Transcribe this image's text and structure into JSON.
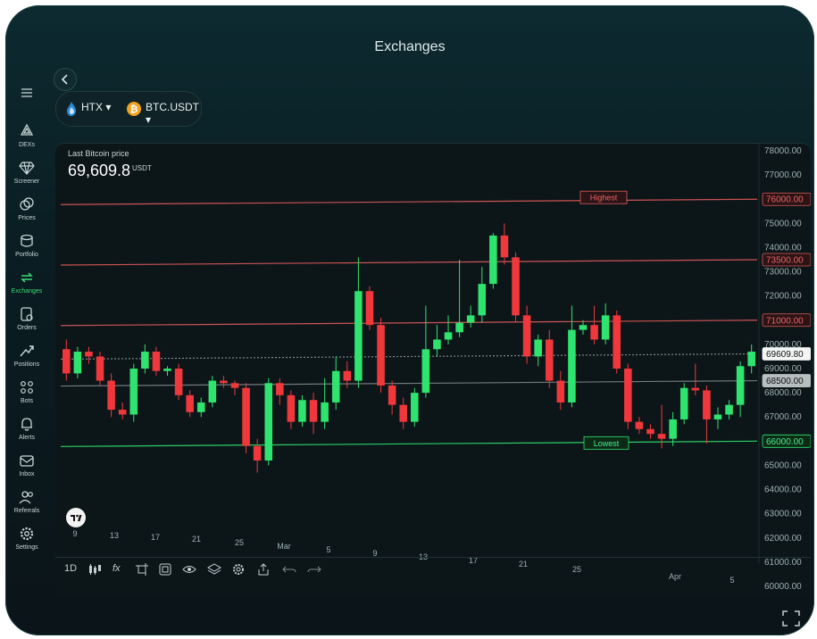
{
  "app": {
    "title": "Exchanges"
  },
  "sidebar": {
    "items": [
      {
        "label": "DEXs",
        "icon": "dex-icon"
      },
      {
        "label": "Screener",
        "icon": "diamond-icon"
      },
      {
        "label": "Prices",
        "icon": "coins-icon"
      },
      {
        "label": "Portfolio",
        "icon": "portfolio-icon"
      },
      {
        "label": "Exchanges",
        "icon": "exchange-arrows-icon",
        "active": true
      },
      {
        "label": "Orders",
        "icon": "orders-icon"
      },
      {
        "label": "Positions",
        "icon": "positions-icon"
      },
      {
        "label": "Bots",
        "icon": "bots-icon"
      },
      {
        "label": "Alerts",
        "icon": "bell-icon"
      },
      {
        "label": "Inbox",
        "icon": "mail-icon"
      },
      {
        "label": "Referrals",
        "icon": "users-icon"
      },
      {
        "label": "Settings",
        "icon": "gear-icon"
      }
    ]
  },
  "selector": {
    "exchange": "HTX",
    "pair": "BTC.USDT"
  },
  "header": {
    "price_label": "Last Bitcoin price",
    "price_value": "69,609.8",
    "price_unit": "USDT"
  },
  "toolbar": {
    "interval": "1D",
    "fx": "fx"
  },
  "colors": {
    "up": "#2fe36f",
    "down": "#f0383c",
    "resistance": "#e05a5a",
    "support": "#2fe36f"
  },
  "chart_data": {
    "type": "candlestick",
    "ylim": [
      60000,
      78000
    ],
    "y_ticks": [
      "78000.00",
      "77000.00",
      "76000.00",
      "75000.00",
      "74000.00",
      "73000.00",
      "72000.00",
      "71000.00",
      "70000.00",
      "69000.00",
      "68000.00",
      "67000.00",
      "66000.00",
      "65000.00",
      "64000.00",
      "63000.00",
      "62000.00",
      "61000.00",
      "60000.00"
    ],
    "x_tick_labels": [
      "9",
      "13",
      "17",
      "21",
      "25",
      "Mar",
      "5",
      "9",
      "13",
      "17",
      "21",
      "25",
      "Apr",
      "5"
    ],
    "levels": [
      {
        "label": "76000.00",
        "value": 76000,
        "kind": "resistance"
      },
      {
        "label": "73500.00",
        "value": 73500,
        "kind": "resistance"
      },
      {
        "label": "71000.00",
        "value": 71000,
        "kind": "resistance"
      },
      {
        "label": "69609.80",
        "value": 69609.8,
        "kind": "current"
      },
      {
        "label": "68500.00",
        "value": 68500,
        "kind": "neutral"
      },
      {
        "label": "66000.00",
        "value": 66000,
        "kind": "support"
      }
    ],
    "annotations": {
      "highest": "Highest",
      "lowest": "Lowest"
    },
    "candles": [
      {
        "o": 69800,
        "c": 68800,
        "h": 70200,
        "l": 68500
      },
      {
        "o": 68800,
        "c": 69700,
        "h": 69900,
        "l": 68600
      },
      {
        "o": 69700,
        "c": 69500,
        "h": 69900,
        "l": 69200
      },
      {
        "o": 69500,
        "c": 68500,
        "h": 69700,
        "l": 68300
      },
      {
        "o": 68500,
        "c": 67300,
        "h": 68800,
        "l": 67000
      },
      {
        "o": 67300,
        "c": 67100,
        "h": 67600,
        "l": 66900
      },
      {
        "o": 67100,
        "c": 69000,
        "h": 69200,
        "l": 66800
      },
      {
        "o": 69000,
        "c": 69700,
        "h": 70000,
        "l": 68800
      },
      {
        "o": 69700,
        "c": 68900,
        "h": 69900,
        "l": 68700
      },
      {
        "o": 68900,
        "c": 69000,
        "h": 69100,
        "l": 68700
      },
      {
        "o": 69000,
        "c": 67900,
        "h": 69200,
        "l": 67700
      },
      {
        "o": 67900,
        "c": 67200,
        "h": 68100,
        "l": 67000
      },
      {
        "o": 67200,
        "c": 67600,
        "h": 67800,
        "l": 67000
      },
      {
        "o": 67600,
        "c": 68500,
        "h": 68700,
        "l": 67400
      },
      {
        "o": 68500,
        "c": 68400,
        "h": 68700,
        "l": 68200
      },
      {
        "o": 68400,
        "c": 68200,
        "h": 68500,
        "l": 67900
      },
      {
        "o": 68200,
        "c": 65800,
        "h": 68400,
        "l": 65500
      },
      {
        "o": 65800,
        "c": 65200,
        "h": 66100,
        "l": 64700
      },
      {
        "o": 65200,
        "c": 68400,
        "h": 68600,
        "l": 65000
      },
      {
        "o": 68400,
        "c": 67900,
        "h": 68600,
        "l": 67500
      },
      {
        "o": 67900,
        "c": 66800,
        "h": 68100,
        "l": 66500
      },
      {
        "o": 66800,
        "c": 67700,
        "h": 67900,
        "l": 66600
      },
      {
        "o": 67700,
        "c": 66800,
        "h": 68000,
        "l": 66300
      },
      {
        "o": 66800,
        "c": 67600,
        "h": 68600,
        "l": 66500
      },
      {
        "o": 67600,
        "c": 68900,
        "h": 69500,
        "l": 67300
      },
      {
        "o": 68900,
        "c": 68500,
        "h": 69300,
        "l": 68200
      },
      {
        "o": 68500,
        "c": 72200,
        "h": 73600,
        "l": 68200
      },
      {
        "o": 72200,
        "c": 70800,
        "h": 72400,
        "l": 70600
      },
      {
        "o": 70800,
        "c": 68300,
        "h": 71100,
        "l": 68000
      },
      {
        "o": 68300,
        "c": 67500,
        "h": 68500,
        "l": 67100
      },
      {
        "o": 67500,
        "c": 66800,
        "h": 67800,
        "l": 66500
      },
      {
        "o": 66800,
        "c": 68000,
        "h": 68200,
        "l": 66600
      },
      {
        "o": 68000,
        "c": 69800,
        "h": 71600,
        "l": 67800
      },
      {
        "o": 69800,
        "c": 70200,
        "h": 70800,
        "l": 69500
      },
      {
        "o": 70200,
        "c": 70500,
        "h": 71200,
        "l": 70000
      },
      {
        "o": 70500,
        "c": 70900,
        "h": 73500,
        "l": 70300
      },
      {
        "o": 70900,
        "c": 71200,
        "h": 71600,
        "l": 70700
      },
      {
        "o": 71200,
        "c": 72500,
        "h": 73200,
        "l": 70900
      },
      {
        "o": 72500,
        "c": 74500,
        "h": 74600,
        "l": 72300
      },
      {
        "o": 74500,
        "c": 73600,
        "h": 75000,
        "l": 73300
      },
      {
        "o": 73600,
        "c": 71200,
        "h": 73800,
        "l": 70900
      },
      {
        "o": 71200,
        "c": 69500,
        "h": 71600,
        "l": 69200
      },
      {
        "o": 69500,
        "c": 70200,
        "h": 70400,
        "l": 69100
      },
      {
        "o": 70200,
        "c": 68500,
        "h": 70600,
        "l": 68200
      },
      {
        "o": 68500,
        "c": 67600,
        "h": 68900,
        "l": 67300
      },
      {
        "o": 67600,
        "c": 70600,
        "h": 71600,
        "l": 67400
      },
      {
        "o": 70600,
        "c": 70800,
        "h": 71000,
        "l": 70400
      },
      {
        "o": 70800,
        "c": 70200,
        "h": 71600,
        "l": 70000
      },
      {
        "o": 70200,
        "c": 71200,
        "h": 71700,
        "l": 70000
      },
      {
        "o": 71200,
        "c": 69000,
        "h": 71400,
        "l": 68800
      },
      {
        "o": 69000,
        "c": 66800,
        "h": 69200,
        "l": 66500
      },
      {
        "o": 66800,
        "c": 66500,
        "h": 67000,
        "l": 66300
      },
      {
        "o": 66500,
        "c": 66300,
        "h": 66700,
        "l": 66100
      },
      {
        "o": 66300,
        "c": 66100,
        "h": 67500,
        "l": 65700
      },
      {
        "o": 66100,
        "c": 66900,
        "h": 67200,
        "l": 65800
      },
      {
        "o": 66900,
        "c": 68200,
        "h": 68400,
        "l": 66700
      },
      {
        "o": 68200,
        "c": 68100,
        "h": 69200,
        "l": 67900
      },
      {
        "o": 68100,
        "c": 66900,
        "h": 68300,
        "l": 65900
      },
      {
        "o": 66900,
        "c": 67100,
        "h": 67400,
        "l": 66500
      },
      {
        "o": 67100,
        "c": 67500,
        "h": 67700,
        "l": 66900
      },
      {
        "o": 67500,
        "c": 69100,
        "h": 69300,
        "l": 67000
      },
      {
        "o": 69100,
        "c": 69700,
        "h": 70000,
        "l": 68800
      }
    ]
  }
}
